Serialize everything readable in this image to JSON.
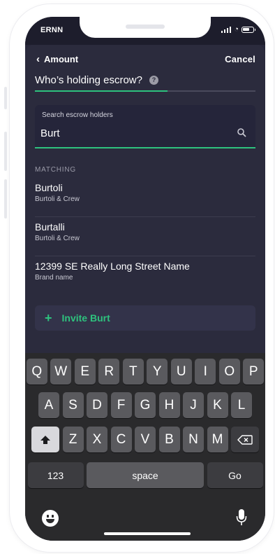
{
  "status_bar": {
    "carrier": "ERNN"
  },
  "nav": {
    "back_label": "Amount",
    "cancel_label": "Cancel"
  },
  "question": {
    "text": "Who’s holding escrow?",
    "help_glyph": "?"
  },
  "progress": {
    "fraction": 0.6
  },
  "search": {
    "label": "Search escrow holders",
    "value": "Burt",
    "icon": "search-icon"
  },
  "results": {
    "heading": "MATCHING",
    "items": [
      {
        "name": "Burtoli",
        "sub": "Burtoli & Crew"
      },
      {
        "name": "Burtalli",
        "sub": "Burtoli & Crew"
      },
      {
        "name": "12399 SE Really  Long Street Name",
        "sub": "Brand name"
      }
    ]
  },
  "invite": {
    "plus_glyph": "+",
    "label": "Invite Burt"
  },
  "keyboard": {
    "row1": [
      "Q",
      "W",
      "E",
      "R",
      "T",
      "Y",
      "U",
      "I",
      "O",
      "P"
    ],
    "row2": [
      "A",
      "S",
      "D",
      "F",
      "G",
      "H",
      "J",
      "K",
      "L"
    ],
    "row3": [
      "Z",
      "X",
      "C",
      "V",
      "B",
      "N",
      "M"
    ],
    "numbers_label": "123",
    "space_label": "space",
    "go_label": "Go",
    "shift_icon": "shift-icon",
    "delete_icon": "delete-icon",
    "emoji_icon": "emoji-icon",
    "mic_icon": "microphone-icon"
  },
  "colors": {
    "accent": "#2ec27e",
    "screen_bg": "#27273a",
    "sheet_bg": "#2b2b3d",
    "keyboard_bg": "#2a2a2c"
  }
}
